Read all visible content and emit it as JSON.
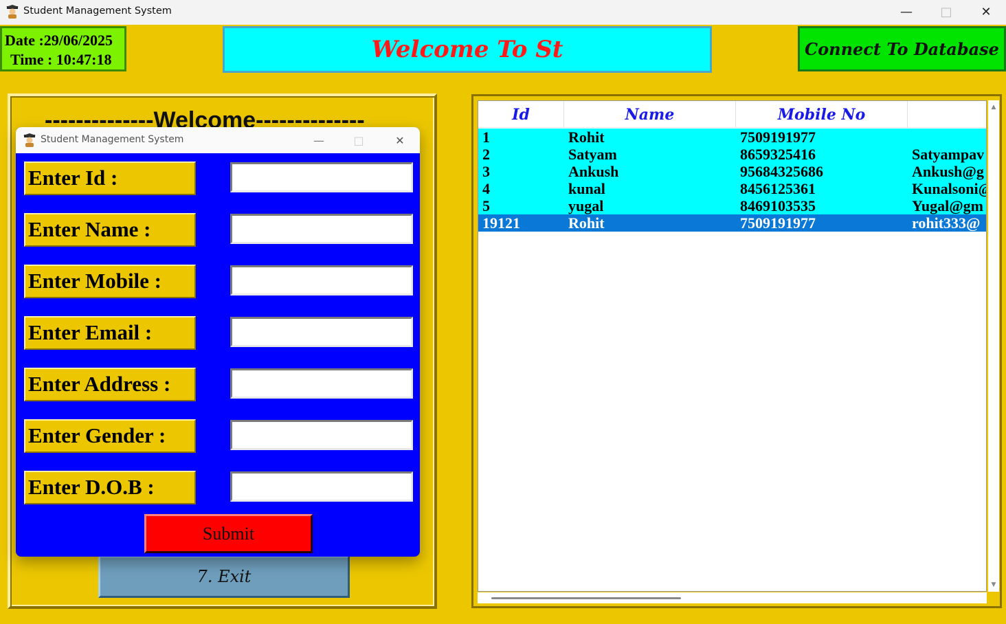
{
  "window": {
    "title": "Student Management System",
    "controls": {
      "minimize": "—",
      "maximize": "□",
      "close": "✕"
    }
  },
  "header": {
    "date_label": "Date :29/06/2025",
    "time_label": "Time : 10:47:18",
    "welcome_banner": "Welcome To St",
    "connect_button": "Connect To Database"
  },
  "menu": {
    "welcome_heading": "--------------Welcome--------------",
    "exit_button": "7.   Exit"
  },
  "table": {
    "columns": [
      "Id",
      "Name",
      "Mobile No",
      ""
    ],
    "rows": [
      {
        "id": "1",
        "name": "Rohit",
        "mobile": "7509191977",
        "email": ""
      },
      {
        "id": "2",
        "name": "Satyam",
        "mobile": "8659325416",
        "email": "Satyampav"
      },
      {
        "id": "3",
        "name": "Ankush",
        "mobile": "95684325686",
        "email": "Ankush@g"
      },
      {
        "id": "4",
        "name": "kunal",
        "mobile": "8456125361",
        "email": "Kunalsoni@"
      },
      {
        "id": "5",
        "name": "yugal",
        "mobile": "8469103535",
        "email": "Yugal@gm"
      },
      {
        "id": "19121",
        "name": "Rohit",
        "mobile": "7509191977",
        "email": "rohit333@"
      }
    ],
    "selected_row": 5
  },
  "dialog": {
    "title": "Student Management System",
    "fields": [
      {
        "label": "Enter Id :",
        "value": ""
      },
      {
        "label": "Enter Name :",
        "value": ""
      },
      {
        "label": "Enter Mobile :",
        "value": ""
      },
      {
        "label": "Enter Email :",
        "value": ""
      },
      {
        "label": "Enter Address :",
        "value": ""
      },
      {
        "label": "Enter Gender :",
        "value": ""
      },
      {
        "label": "Enter D.O.B :",
        "value": ""
      }
    ],
    "submit_button": "Submit"
  },
  "icons": {
    "app": "student-graduate-icon",
    "scroll_up": "▲",
    "scroll_down": "▼"
  },
  "colors": {
    "background": "#ecc700",
    "banner": "#00ffff",
    "banner_text": "#ff1a1a",
    "connect": "#00e400",
    "datetime": "#7cf200",
    "dialog": "#0000ff",
    "submit": "#ff0000",
    "row_highlight": "#00ffff",
    "row_selected": "#0a78d7"
  }
}
